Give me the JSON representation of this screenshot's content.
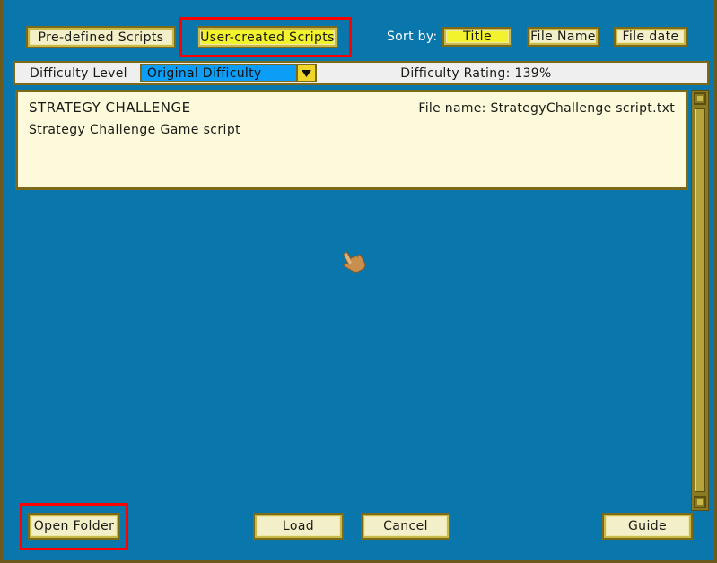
{
  "window": {
    "background_color": "#0a77ac",
    "frame_color": "#6b5a1e"
  },
  "tabs": {
    "predefined_label": "Pre-defined Scripts",
    "usercreated_label": "User-created Scripts",
    "selected": "User-created Scripts",
    "selected_color": "#f2f22d"
  },
  "sort": {
    "label": "Sort by:",
    "options": [
      {
        "label": "Title",
        "selected": true
      },
      {
        "label": "File Name",
        "selected": false
      },
      {
        "label": "File date",
        "selected": false
      }
    ],
    "title_label": "Title",
    "filename_label": "File Name",
    "filedate_label": "File date"
  },
  "difficulty": {
    "label": "Difficulty Level",
    "selected_value": "Original Difficulty",
    "dropdown_icon": "chevron-down-icon",
    "highlight_color": "#0c9ef7",
    "rating_text": "Difficulty Rating: 139%",
    "rating_value": "139%"
  },
  "script_list": {
    "items": [
      {
        "title": "STRATEGY CHALLENGE",
        "file_name_label": "File name: StrategyChallenge script.txt",
        "description": "Strategy Challenge Game script"
      }
    ]
  },
  "scrollbar": {
    "up_icon": "scroll-up-icon",
    "down_icon": "scroll-down-icon",
    "thumb_name": "scroll-thumb"
  },
  "cursor": {
    "icon": "pointing-hand-cursor"
  },
  "footer": {
    "open_folder_label": "Open Folder",
    "load_label": "Load",
    "cancel_label": "Cancel",
    "guide_label": "Guide"
  },
  "annotations": {
    "color": "#ff0000",
    "boxes": [
      {
        "target": "User-created Scripts"
      },
      {
        "target": "Open Folder"
      }
    ]
  }
}
